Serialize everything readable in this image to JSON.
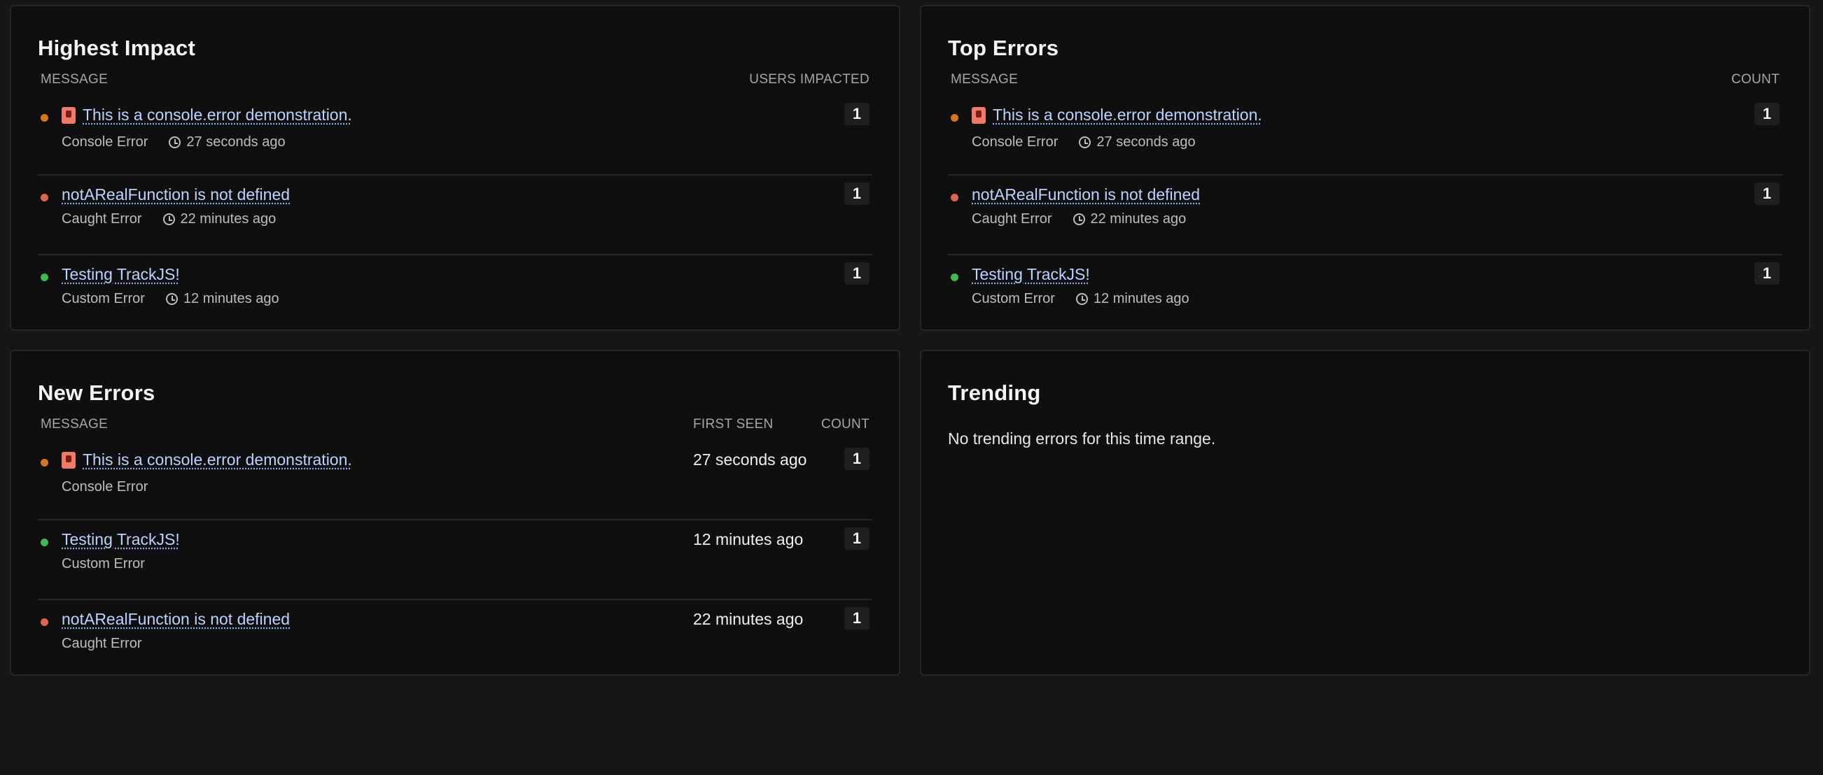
{
  "colors": {
    "console": "#d9741f",
    "caught": "#e0644f",
    "custom": "#3fb950"
  },
  "highest_impact": {
    "title": "Highest Impact",
    "col_message": "MESSAGE",
    "col_count": "USERS IMPACTED",
    "rows": [
      {
        "message": "This is a console.error demonstration.",
        "type": "Console Error",
        "time": "27 seconds ago",
        "count": "1",
        "severity": "console",
        "icon": "console-error-emoji-icon"
      },
      {
        "message": "notARealFunction is not defined",
        "type": "Caught Error",
        "time": "22 minutes ago",
        "count": "1",
        "severity": "caught"
      },
      {
        "message": "Testing TrackJS!",
        "type": "Custom Error",
        "time": "12 minutes ago",
        "count": "1",
        "severity": "custom"
      }
    ]
  },
  "top_errors": {
    "title": "Top Errors",
    "col_message": "MESSAGE",
    "col_count": "COUNT",
    "rows": [
      {
        "message": "This is a console.error demonstration.",
        "type": "Console Error",
        "time": "27 seconds ago",
        "count": "1",
        "severity": "console",
        "icon": "console-error-emoji-icon"
      },
      {
        "message": "notARealFunction is not defined",
        "type": "Caught Error",
        "time": "22 minutes ago",
        "count": "1",
        "severity": "caught"
      },
      {
        "message": "Testing TrackJS!",
        "type": "Custom Error",
        "time": "12 minutes ago",
        "count": "1",
        "severity": "custom"
      }
    ]
  },
  "new_errors": {
    "title": "New Errors",
    "col_message": "MESSAGE",
    "col_first_seen": "FIRST SEEN",
    "col_count": "COUNT",
    "rows": [
      {
        "message": "This is a console.error demonstration.",
        "type": "Console Error",
        "first_seen": "27 seconds ago",
        "count": "1",
        "severity": "console",
        "icon": "console-error-emoji-icon"
      },
      {
        "message": "Testing TrackJS!",
        "type": "Custom Error",
        "first_seen": "12 minutes ago",
        "count": "1",
        "severity": "custom"
      },
      {
        "message": "notARealFunction is not defined",
        "type": "Caught Error",
        "first_seen": "22 minutes ago",
        "count": "1",
        "severity": "caught"
      }
    ]
  },
  "trending": {
    "title": "Trending",
    "empty_text": "No trending errors for this time range."
  }
}
